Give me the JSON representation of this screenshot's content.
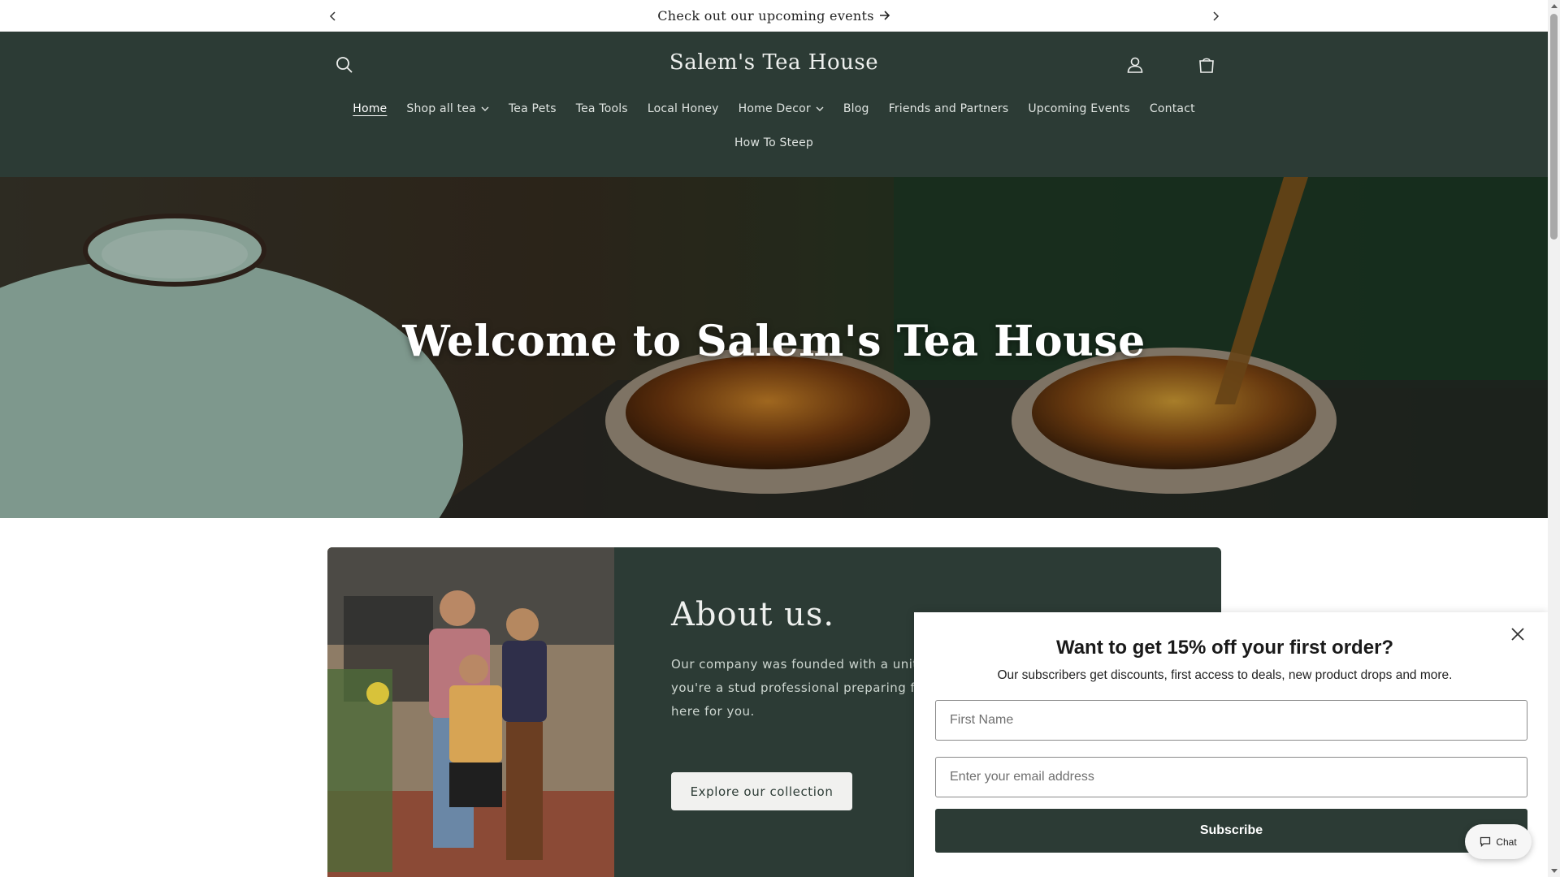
{
  "announcement": {
    "text": "Check out our upcoming events"
  },
  "header": {
    "logo": "Salem's Tea House",
    "nav_row1": [
      {
        "label": "Home",
        "active": true,
        "dropdown": false
      },
      {
        "label": "Shop all tea",
        "active": false,
        "dropdown": true
      },
      {
        "label": "Tea Pets",
        "active": false,
        "dropdown": false
      },
      {
        "label": "Tea Tools",
        "active": false,
        "dropdown": false
      },
      {
        "label": "Local Honey",
        "active": false,
        "dropdown": false
      },
      {
        "label": "Home Decor",
        "active": false,
        "dropdown": true
      },
      {
        "label": "Blog",
        "active": false,
        "dropdown": false
      },
      {
        "label": "Friends and Partners",
        "active": false,
        "dropdown": false
      },
      {
        "label": "Upcoming Events",
        "active": false,
        "dropdown": false
      },
      {
        "label": "Contact",
        "active": false,
        "dropdown": false
      }
    ],
    "nav_row2": [
      {
        "label": "How To Steep"
      }
    ]
  },
  "hero": {
    "title": "Welcome to Salem's Tea House"
  },
  "about": {
    "heading": "About us.",
    "text": "Our company was founded with a united reasonable prices. Whether you're a stud professional preparing for a big meeting blend, we are here for you.",
    "button": "Explore our collection"
  },
  "popup": {
    "title": "Want to get 15% off your first order?",
    "subtitle": "Our subscribers get discounts, first access to deals, new product drops and more.",
    "first_name_placeholder": "First Name",
    "email_placeholder": "Enter your email address",
    "submit": "Subscribe"
  },
  "chat": {
    "label": "Chat"
  },
  "colors": {
    "header_bg": "#2c3b35",
    "accent": "#2c3b35"
  }
}
